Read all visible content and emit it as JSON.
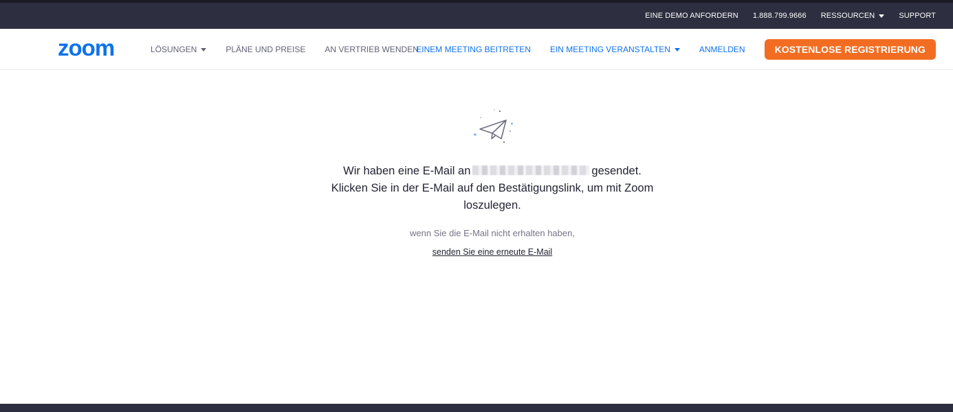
{
  "topbar": {
    "demo": "EINE DEMO ANFORDERN",
    "phone": "1.888.799.9666",
    "resources": "RESSOURCEN",
    "support": "SUPPORT"
  },
  "nav": {
    "logo": "zoom",
    "solutions": "LÖSUNGEN",
    "plans": "PLÄNE UND PREISE",
    "sales": "AN VERTRIEB WENDEN",
    "join": "EINEM MEETING BEITRETEN",
    "host": "EIN MEETING VERANSTALTEN",
    "signin": "ANMELDEN",
    "signup": "KOSTENLOSE REGISTRIERUNG"
  },
  "main": {
    "icon": "paper-plane-icon",
    "line1_pre": "Wir haben eine E-Mail an",
    "line1_post": "gesendet.",
    "line2": "Klicken Sie in der E-Mail auf den Bestätigungslink, um mit Zoom loszulegen.",
    "not_received": "wenn Sie die E-Mail nicht erhalten haben,",
    "resend": "senden Sie eine erneute E-Mail"
  },
  "colors": {
    "topbar_bg": "#2d2e3f",
    "brand_blue": "#0e72ed",
    "cta_orange": "#f26d21"
  }
}
